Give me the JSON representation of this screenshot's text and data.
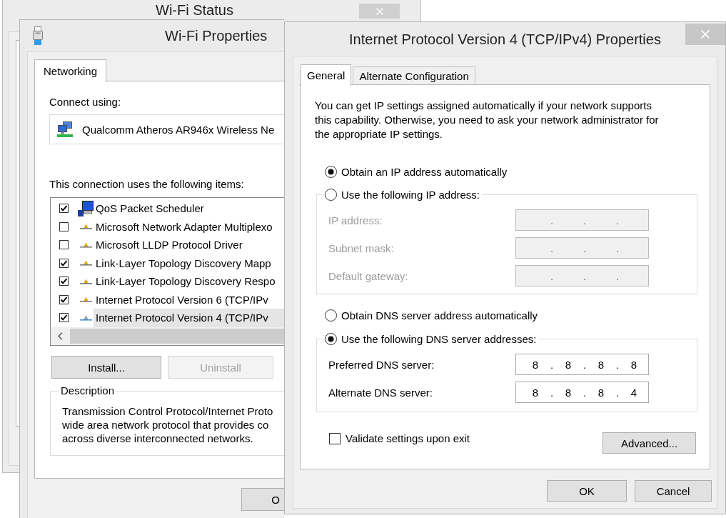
{
  "status_window": {
    "title": "Wi-Fi Status"
  },
  "properties_window": {
    "title": "Wi-Fi Properties",
    "tabs": [
      {
        "label": "Networking",
        "selected": true
      }
    ],
    "connect_using_label": "Connect using:",
    "adapter": "Qualcomm Atheros AR946x Wireless Ne",
    "items_label": "This connection uses the following items:",
    "items": [
      {
        "label": "QoS Packet Scheduler",
        "kind": "service",
        "checked": true,
        "selected": false
      },
      {
        "label": "Microsoft Network Adapter Multiplexo",
        "kind": "protocol",
        "checked": false,
        "selected": false
      },
      {
        "label": "Microsoft LLDP Protocol Driver",
        "kind": "protocol",
        "checked": false,
        "selected": false
      },
      {
        "label": "Link-Layer Topology Discovery Mapp",
        "kind": "protocol",
        "checked": true,
        "selected": false
      },
      {
        "label": "Link-Layer Topology Discovery Respo",
        "kind": "protocol",
        "checked": true,
        "selected": false
      },
      {
        "label": "Internet Protocol Version 6 (TCP/IPv",
        "kind": "protocol",
        "checked": true,
        "selected": false
      },
      {
        "label": "Internet Protocol Version 4 (TCP/IPv",
        "kind": "protocol",
        "checked": true,
        "selected": true
      }
    ],
    "buttons": [
      {
        "label": "Install...",
        "disabled": false
      },
      {
        "label": "Uninstall",
        "disabled": true
      }
    ],
    "description": {
      "legend": "Description",
      "text": "Transmission Control Protocol/Internet Proto\nwide area network protocol that provides co\nacross diverse interconnected networks."
    },
    "footer_buttons": [
      "O"
    ]
  },
  "ipv4_window": {
    "title": "Internet Protocol Version 4 (TCP/IPv4) Properties",
    "tabs": [
      {
        "label": "General",
        "selected": true
      },
      {
        "label": "Alternate Configuration",
        "selected": false
      }
    ],
    "intro": "You can get IP settings assigned automatically if your network supports this capability. Otherwise, you need to ask your network administrator for the appropriate IP settings.",
    "ip_settings": {
      "options": [
        {
          "label": "Obtain an IP address automatically",
          "selected": true
        },
        {
          "label": "Use the following IP address:",
          "selected": false
        }
      ],
      "fields": [
        {
          "label": "IP address:",
          "separators": [
            ".",
            ".",
            "."
          ]
        },
        {
          "label": "Subnet mask:",
          "separators": [
            ".",
            ".",
            "."
          ]
        },
        {
          "label": "Default gateway:",
          "separators": [
            ".",
            ".",
            "."
          ]
        }
      ]
    },
    "dns_settings": {
      "options": [
        {
          "label": "Obtain DNS server address automatically",
          "selected": false
        },
        {
          "label": "Use the following DNS server addresses:",
          "selected": true
        }
      ],
      "fields": [
        {
          "label": "Preferred DNS server:",
          "octets": [
            "8",
            "8",
            "8",
            "8"
          ],
          "separators": [
            ".",
            ".",
            "."
          ]
        },
        {
          "label": "Alternate DNS server:",
          "octets": [
            "8",
            "8",
            "8",
            "4"
          ],
          "separators": [
            ".",
            ".",
            "."
          ]
        }
      ]
    },
    "validate_on_exit": {
      "label": "Validate settings upon exit",
      "checked": false
    },
    "advanced_button": "Advanced...",
    "buttons": [
      "OK",
      "Cancel"
    ]
  }
}
